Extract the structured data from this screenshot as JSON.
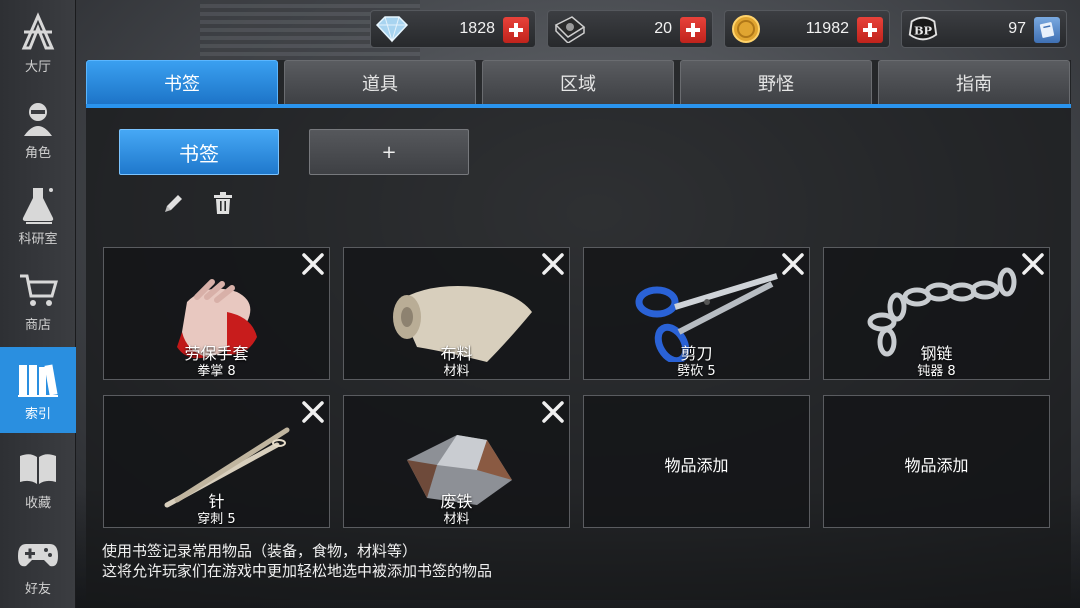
{
  "sidebar": {
    "items": [
      {
        "label": "大厅",
        "icon": "lobby-icon"
      },
      {
        "label": "角色",
        "icon": "character-icon"
      },
      {
        "label": "科研室",
        "icon": "flask-icon"
      },
      {
        "label": "商店",
        "icon": "cart-icon"
      },
      {
        "label": "索引",
        "icon": "books-icon"
      },
      {
        "label": "收藏",
        "icon": "book-icon"
      },
      {
        "label": "好友",
        "icon": "gamepad-icon"
      }
    ],
    "active_index": 4
  },
  "currency": [
    {
      "name": "diamond",
      "icon": "diamond-icon",
      "value": "1828"
    },
    {
      "name": "storage",
      "icon": "hard-drive-icon",
      "value": "20"
    },
    {
      "name": "gold",
      "icon": "coin-icon",
      "value": "11982"
    },
    {
      "name": "bp",
      "icon": "bp-badge-icon",
      "value": "97"
    }
  ],
  "tabs": [
    "书签",
    "道具",
    "区域",
    "野怪",
    "指南"
  ],
  "active_tab": 0,
  "bookmark_tabs": {
    "active_label": "书签",
    "add_label": "+"
  },
  "items": [
    {
      "name": "劳保手套",
      "sub": "拳掌 8",
      "icon": "gloves-icon"
    },
    {
      "name": "布料",
      "sub": "材料",
      "icon": "cloth-roll-icon"
    },
    {
      "name": "剪刀",
      "sub": "劈砍 5",
      "icon": "scissors-icon"
    },
    {
      "name": "钢链",
      "sub": "钝器 8",
      "icon": "chain-icon"
    },
    {
      "name": "针",
      "sub": "穿刺 5",
      "icon": "needle-icon"
    },
    {
      "name": "废铁",
      "sub": "材料",
      "icon": "scrap-metal-icon"
    }
  ],
  "empty_slot_label": "物品添加",
  "hint": {
    "line1": "使用书签记录常用物品（装备，食物，材料等）",
    "line2": "这将允许玩家们在游戏中更加轻松地选中被添加书签的物品"
  },
  "colors": {
    "accent": "#2a94ee",
    "add_red": "#d9342c"
  }
}
